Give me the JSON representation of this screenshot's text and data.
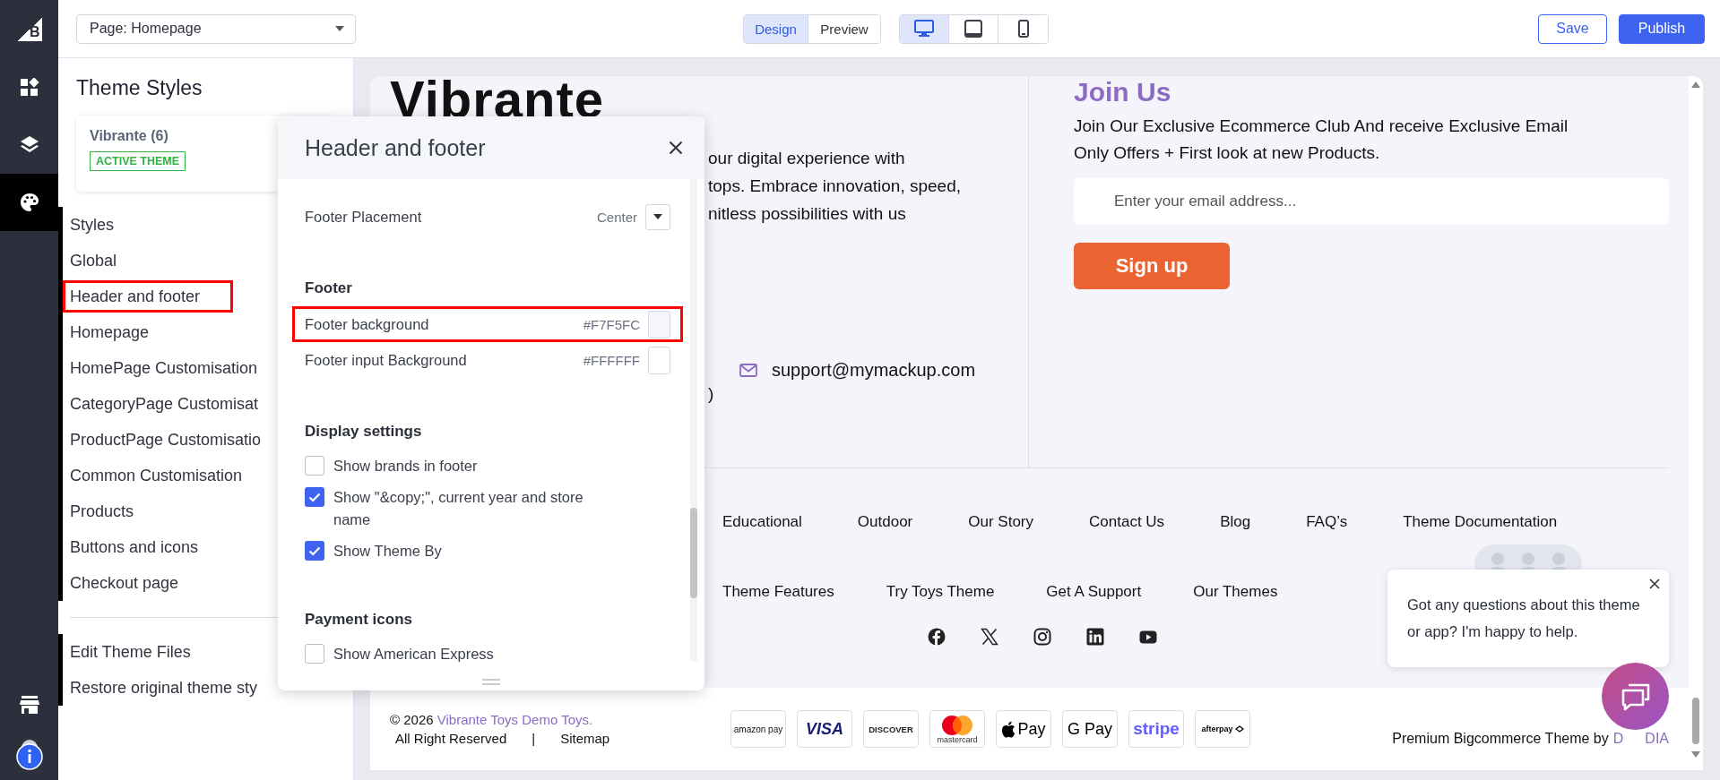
{
  "rail": {
    "brand_mark": "B",
    "items": [
      {
        "kind": "widgets",
        "selected": false
      },
      {
        "kind": "layers",
        "selected": false
      },
      {
        "kind": "palette",
        "selected": true
      }
    ],
    "bottom": [
      {
        "kind": "store"
      },
      {
        "kind": "info"
      }
    ]
  },
  "topbar": {
    "page_select": {
      "value": "Page: Homepage"
    },
    "view_modes": [
      {
        "label": "Design",
        "selected": true
      },
      {
        "label": "Preview",
        "selected": false
      }
    ],
    "devices": [
      {
        "kind": "desktop",
        "selected": true
      },
      {
        "kind": "tablet",
        "selected": false
      },
      {
        "kind": "phone",
        "selected": false
      }
    ],
    "buttons": [
      {
        "label": "Save",
        "kind": "outline"
      },
      {
        "label": "Publish",
        "kind": "primary"
      }
    ]
  },
  "sidebar": {
    "title": "Theme Styles",
    "theme_card": {
      "name": "Vibrante (6)",
      "badge": "ACTIVE THEME"
    },
    "items": [
      {
        "label": "Styles",
        "highlighted": false
      },
      {
        "label": "Global",
        "highlighted": false
      },
      {
        "label": "Header and footer",
        "highlighted": true
      },
      {
        "label": "Homepage",
        "highlighted": false
      },
      {
        "label": "HomePage Customisation",
        "highlighted": false
      },
      {
        "label": "CategoryPage Customisat",
        "highlighted": false
      },
      {
        "label": "ProductPage Customisatio",
        "highlighted": false
      },
      {
        "label": "Common Customisation",
        "highlighted": false
      },
      {
        "label": "Products",
        "highlighted": false
      },
      {
        "label": "Buttons and icons",
        "highlighted": false
      },
      {
        "label": "Checkout page",
        "highlighted": false
      }
    ],
    "bottom_items": [
      {
        "label": "Edit Theme Files"
      },
      {
        "label": "Restore original theme sty"
      }
    ]
  },
  "panel": {
    "title": "Header and footer",
    "rows": [
      {
        "kind": "select",
        "label": "Footer Placement",
        "value": "Center"
      },
      {
        "kind": "section",
        "label": "Footer"
      },
      {
        "kind": "color",
        "label": "Footer background",
        "value": "#F7F5FC",
        "highlighted": true
      },
      {
        "kind": "color",
        "label": "Footer input Background",
        "value": "#FFFFFF",
        "highlighted": false
      },
      {
        "kind": "section",
        "label": "Display settings"
      },
      {
        "kind": "checkbox",
        "label": "Show brands in footer",
        "checked": false
      },
      {
        "kind": "checkbox",
        "label": "Show \"&copy;\", current year and store name",
        "checked": true
      },
      {
        "kind": "checkbox",
        "label": "Show Theme By",
        "checked": true
      },
      {
        "kind": "section",
        "label": "Payment icons"
      },
      {
        "kind": "checkbox",
        "label": "Show American Express",
        "checked": false
      }
    ]
  },
  "preview": {
    "logo": "Vibrante",
    "description_lines": [
      "our digital experience with",
      "tops. Embrace innovation, speed,",
      "nitless possibilities with us"
    ],
    "contact_email": "support@mymackup.com",
    "contact_fragment": ")",
    "join": {
      "title": "Join Us",
      "text": "Join Our Exclusive Ecommerce Club And receive Exclusive Email Only Offers + First look at new Products.",
      "placeholder": "Enter your email address...",
      "button": "Sign up"
    },
    "link_rows": [
      [
        "Educational",
        "Outdoor",
        "Our Story",
        "Contact Us",
        "Blog",
        "FAQ’s",
        "Theme Documentation"
      ],
      [
        "Theme Features",
        "Try Toys Theme",
        "Get A Support",
        "Our Themes"
      ]
    ],
    "social": [
      {
        "kind": "facebook"
      },
      {
        "kind": "x"
      },
      {
        "kind": "instagram"
      },
      {
        "kind": "linkedin"
      },
      {
        "kind": "youtube"
      }
    ],
    "footer": {
      "copyright": "© 2026",
      "store_link": "Vibrante Toys Demo Toys.",
      "bottom_links": [
        "All Right Reserved",
        "|",
        "Sitemap"
      ],
      "payments": [
        {
          "kind": "amazonpay",
          "label": "amazon pay"
        },
        {
          "kind": "visa",
          "label": "VISA"
        },
        {
          "kind": "discover",
          "label": "DISCOVER"
        },
        {
          "kind": "mastercard",
          "label": "mastercard"
        },
        {
          "kind": "applepay",
          "label": "Pay"
        },
        {
          "kind": "googlepay",
          "label": "G Pay"
        },
        {
          "kind": "stripe",
          "label": "stripe"
        },
        {
          "kind": "afterpay",
          "label": "afterpay"
        }
      ],
      "credit": "Premium Bigcommerce Theme by",
      "credit_link_parts": [
        "D",
        "DIA"
      ]
    },
    "chat": {
      "message": "Got any questions about this theme or app? I'm happy to help."
    }
  }
}
